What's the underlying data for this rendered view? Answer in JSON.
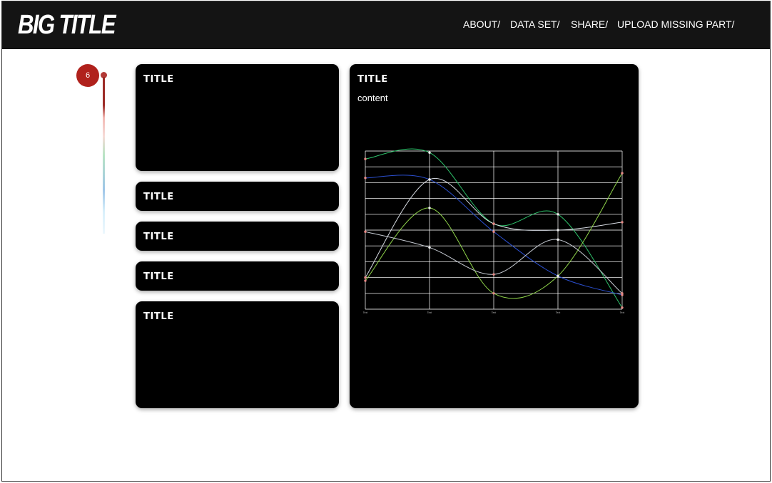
{
  "header": {
    "brand": "BIG TITLE",
    "nav": [
      "ABOUT/",
      "DATA SET/",
      "SHARE/",
      "UPLOAD MISSING PART/"
    ]
  },
  "timeline": {
    "current_step": "6",
    "accent_color": "#b0211c"
  },
  "cards": {
    "top": {
      "title": "TITLE"
    },
    "row1": {
      "title": "TITLE"
    },
    "row2": {
      "title": "TITLE"
    },
    "row3": {
      "title": "TITLE"
    },
    "bottom": {
      "title": "TITLE"
    },
    "chart": {
      "title": "TITLE",
      "content": "content"
    }
  },
  "chart_data": {
    "type": "line",
    "title": "",
    "xlabel": "",
    "ylabel": "",
    "x": [
      "Text",
      "Text",
      "Text",
      "Text",
      "Text"
    ],
    "ylim": [
      0,
      100
    ],
    "grid": true,
    "legend": "none",
    "smooth": true,
    "series": [
      {
        "color": "#2ec26b",
        "values": [
          95,
          99,
          54,
          60,
          1
        ]
      },
      {
        "color": "#2b4fcf",
        "values": [
          83,
          82,
          49,
          21,
          9
        ]
      },
      {
        "color": "#d7dce3",
        "values": [
          20,
          82,
          54,
          50,
          55
        ]
      },
      {
        "color": "#8fd44a",
        "values": [
          18,
          64,
          10,
          21,
          86
        ]
      },
      {
        "color": "#c6cbd3",
        "values": [
          49,
          39,
          22,
          44,
          10
        ]
      }
    ],
    "marker_colors": [
      "#e88a86",
      "#eeeeee",
      "#e88a86",
      "#eeeeee",
      "#e88a86"
    ]
  }
}
